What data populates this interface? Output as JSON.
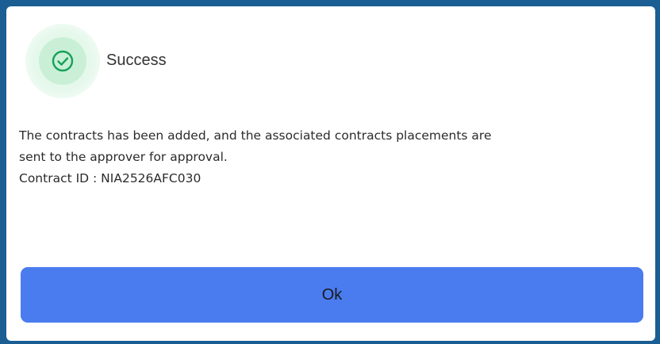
{
  "dialog": {
    "title": "Success",
    "icon": "check-circle-icon",
    "message_line1": "The contracts has been added, and the associated contracts placements are",
    "message_line2": "sent to the approver for approval.",
    "contract_id_text": "Contract ID : NIA2526AFC030",
    "ok_label": "Ok"
  },
  "colors": {
    "frame": "#1a5e94",
    "success_green": "#18a05a",
    "icon_bg": "#c9f0d6",
    "button": "#4a7cf0"
  }
}
